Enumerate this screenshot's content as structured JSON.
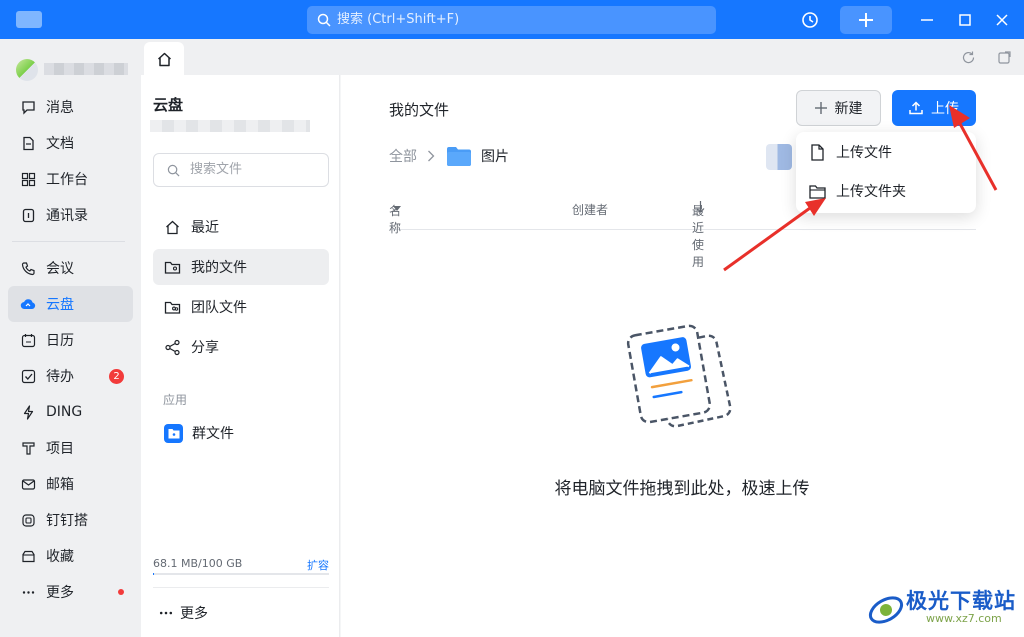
{
  "titlebar": {
    "search_placeholder": "搜索 (Ctrl+Shift+F)",
    "accent": "#1677ff"
  },
  "leftnav": {
    "items": [
      {
        "label": "消息",
        "icon": "message-icon"
      },
      {
        "label": "文档",
        "icon": "document-icon"
      },
      {
        "label": "工作台",
        "icon": "workbench-icon"
      },
      {
        "label": "通讯录",
        "icon": "contacts-icon"
      },
      {
        "label": "会议",
        "icon": "phone-icon"
      },
      {
        "label": "云盘",
        "icon": "cloud-icon",
        "active": true
      },
      {
        "label": "日历",
        "icon": "calendar-icon"
      },
      {
        "label": "待办",
        "icon": "todo-icon",
        "badge": "2"
      },
      {
        "label": "DING",
        "icon": "lightning-icon"
      },
      {
        "label": "项目",
        "icon": "project-icon"
      },
      {
        "label": "邮箱",
        "icon": "mail-icon"
      },
      {
        "label": "钉钉搭",
        "icon": "builder-icon"
      },
      {
        "label": "收藏",
        "icon": "favorites-icon"
      },
      {
        "label": "更多",
        "icon": "more-icon",
        "dot": true
      }
    ]
  },
  "panel": {
    "title": "云盘",
    "search_placeholder": "搜索文件",
    "items": [
      {
        "label": "最近",
        "icon": "home-icon"
      },
      {
        "label": "我的文件",
        "icon": "my-files-icon",
        "active": true
      },
      {
        "label": "团队文件",
        "icon": "team-files-icon"
      },
      {
        "label": "分享",
        "icon": "share-icon"
      }
    ],
    "apps_section": "应用",
    "app_item": "群文件",
    "storage_text": "68.1 MB/100 GB",
    "storage_fraction": 0.0007,
    "expand_label": "扩容",
    "more_label": "更多"
  },
  "main": {
    "title": "我的文件",
    "new_button": "新建",
    "upload_button": "上传",
    "breadcrumb_root": "全部",
    "breadcrumb_current": "图片",
    "columns": {
      "name": "名称",
      "creator": "创建者",
      "recent": "最近使用"
    },
    "empty_text": "将电脑文件拖拽到此处，极速上传",
    "upload_menu": {
      "upload_file": "上传文件",
      "upload_folder": "上传文件夹"
    }
  },
  "watermark": {
    "name": "极光下载站",
    "url": "www.xz7.com"
  }
}
